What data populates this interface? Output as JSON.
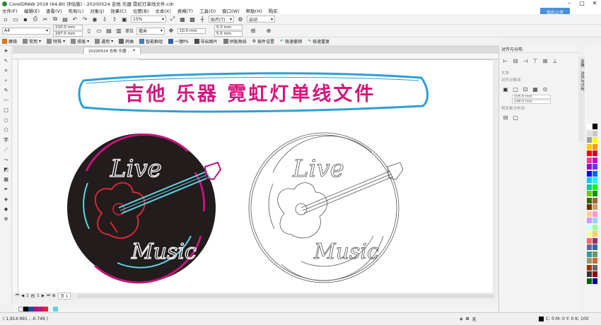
{
  "window": {
    "title": "CorelDRAW 2018 (64-Bit 评估版) - 20200524 吉他 乐器 霓虹灯单线文件.cdr",
    "upload_label": "我的上传"
  },
  "menu": [
    "文件(F)",
    "编辑(E)",
    "查看(V)",
    "布局(L)",
    "对象(J)",
    "效果(C)",
    "位图(B)",
    "文本(X)",
    "表格(T)",
    "工具(O)",
    "窗口(W)",
    "帮助(H)",
    "购买"
  ],
  "toolbar1": {
    "zoom": "15%",
    "snap_label": "贴齐(T)",
    "launch_label": "启动"
  },
  "toolbar2": {
    "page_size": "A4",
    "width": "210.0 mm",
    "height": "297.0 mm",
    "units_label": "单位",
    "units": "毫米",
    "nudge": "10.0 mm",
    "dup_x": "5.0 mm",
    "dup_y": "5.0 mm"
  },
  "toolbar3": [
    "魔镜",
    "常用",
    "特殊",
    "排版",
    "通用",
    "转曲",
    "智能群组",
    "一键PS",
    "导出图片",
    "拼版角线",
    "插件设置",
    "极速撤销",
    "极速重复"
  ],
  "doc_tab": "20200524 吉他 乐器 ...",
  "canvas": {
    "banner_text": "吉他 乐器 霓虹灯单线文件",
    "live_text": "Live",
    "music_text": "Music"
  },
  "page_nav": {
    "current": "1",
    "of": "的",
    "total": "1",
    "page_tab": "页 1"
  },
  "status": {
    "coords": "( 1,914.991 , -0.749 )",
    "fill_none": "无",
    "color_info": "C: 0 M: 0 Y: 0 K: 100"
  },
  "panel": {
    "title": "对齐与分布",
    "group_text": "文本",
    "group_distribute": "对齐对象到",
    "group_spacing": "将对象分布到",
    "pos_x": "105.0 mm",
    "pos_y": "148.5 mm",
    "side_tab_1": "变换",
    "side_tab_2": "对齐与分布"
  },
  "colors": {
    "neon_pink": "#c2157a",
    "neon_blue": "#5fd3e6",
    "neon_red": "#d8283c",
    "disc": "#221c1c",
    "banner_blue": "#2e9fd6",
    "banner_text": "#d3177e"
  }
}
